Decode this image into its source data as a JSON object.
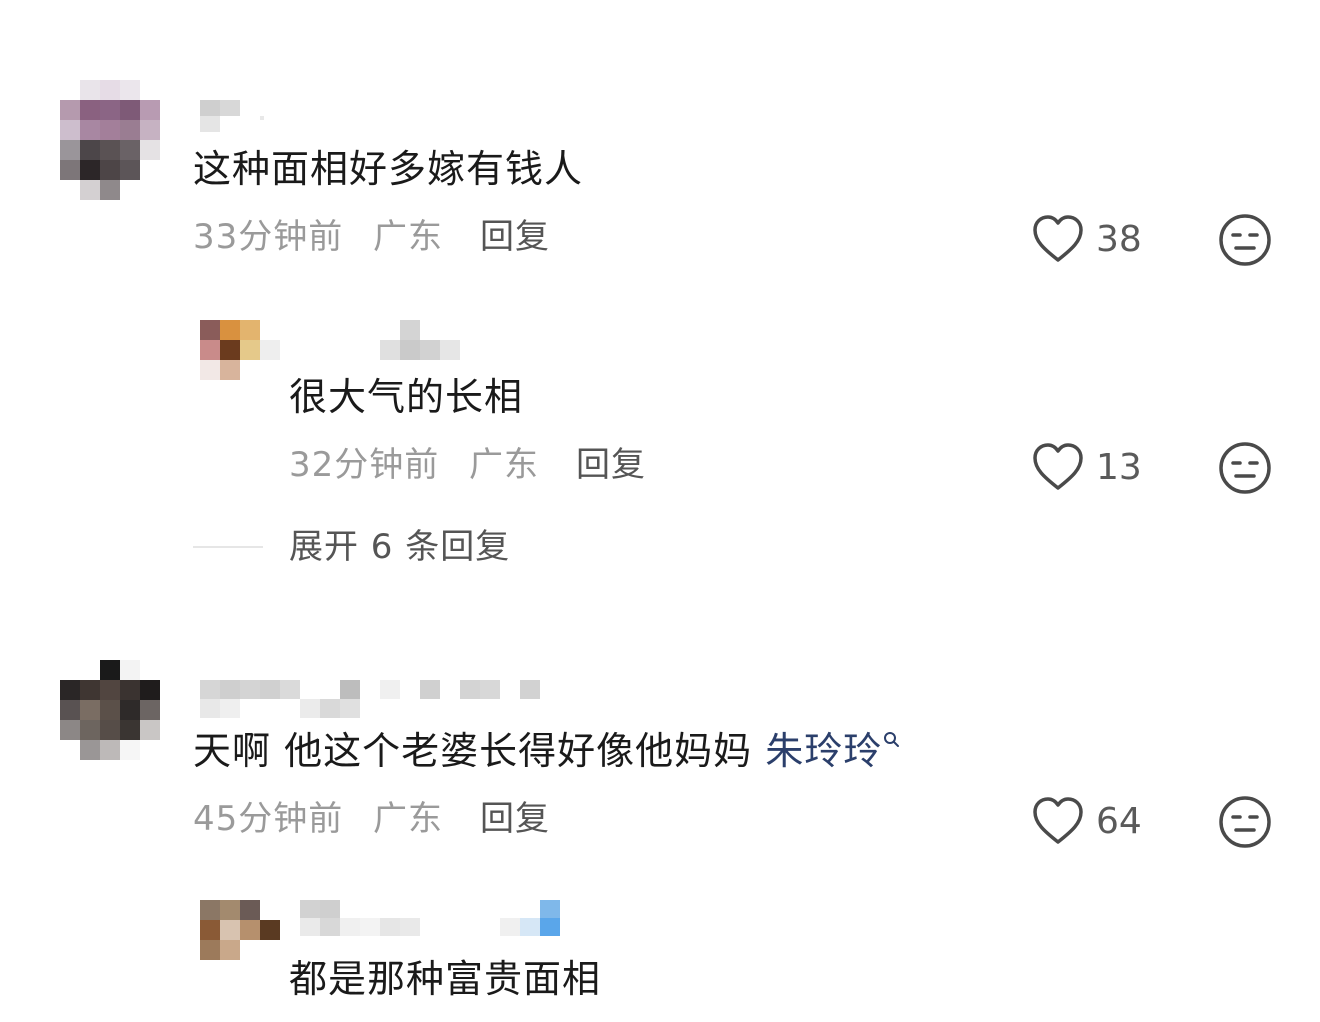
{
  "comments": [
    {
      "text": "这种面相好多嫁有钱人",
      "time": "33分钟前",
      "location": "广东",
      "reply_label": "回复",
      "likes": "38",
      "replies": [
        {
          "text": "很大气的长相",
          "time": "32分钟前",
          "location": "广东",
          "reply_label": "回复",
          "likes": "13"
        }
      ],
      "expand_label": "展开 6 条回复"
    },
    {
      "text": "天啊 他这个老婆长得好像他妈妈",
      "mention": "朱玲玲",
      "time": "45分钟前",
      "location": "广东",
      "reply_label": "回复",
      "likes": "64",
      "replies": [
        {
          "text": "都是那种富贵面相"
        }
      ]
    }
  ],
  "icons": {
    "like": "heart-outline-icon",
    "dislike": "neutral-face-icon",
    "search": "search-icon"
  },
  "colors": {
    "meta": "#9a9a9a",
    "mention": "#2b3f6b",
    "icon": "#4a4a4a"
  }
}
